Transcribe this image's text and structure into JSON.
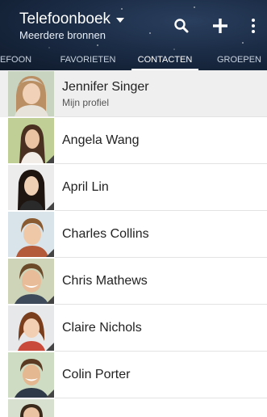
{
  "header": {
    "title": "Telefoonboek",
    "subtitle": "Meerdere bronnen",
    "actions": [
      {
        "icon": "search-icon"
      },
      {
        "icon": "plus-icon"
      },
      {
        "icon": "more-vertical-icon"
      }
    ]
  },
  "tabs": [
    {
      "label": "EFOON",
      "active": false
    },
    {
      "label": "FAVORIETEN",
      "active": false
    },
    {
      "label": "CONTACTEN",
      "active": true
    },
    {
      "label": "GROEPEN",
      "active": false
    }
  ],
  "contacts": [
    {
      "name": "Jennifer Singer",
      "subtitle": "Mijn profiel",
      "is_profile": true
    },
    {
      "name": "Angela Wang"
    },
    {
      "name": "April Lin"
    },
    {
      "name": "Charles Collins"
    },
    {
      "name": "Chris Mathews"
    },
    {
      "name": "Claire Nichols"
    },
    {
      "name": "Colin Porter"
    }
  ],
  "colors": {
    "header_bg": "#1b2c46",
    "tab_active": "#ffffff",
    "tab_inactive": "#c9d3df",
    "profile_row_bg": "#efefef",
    "divider": "#e3e3e3",
    "name_text": "#222222"
  }
}
